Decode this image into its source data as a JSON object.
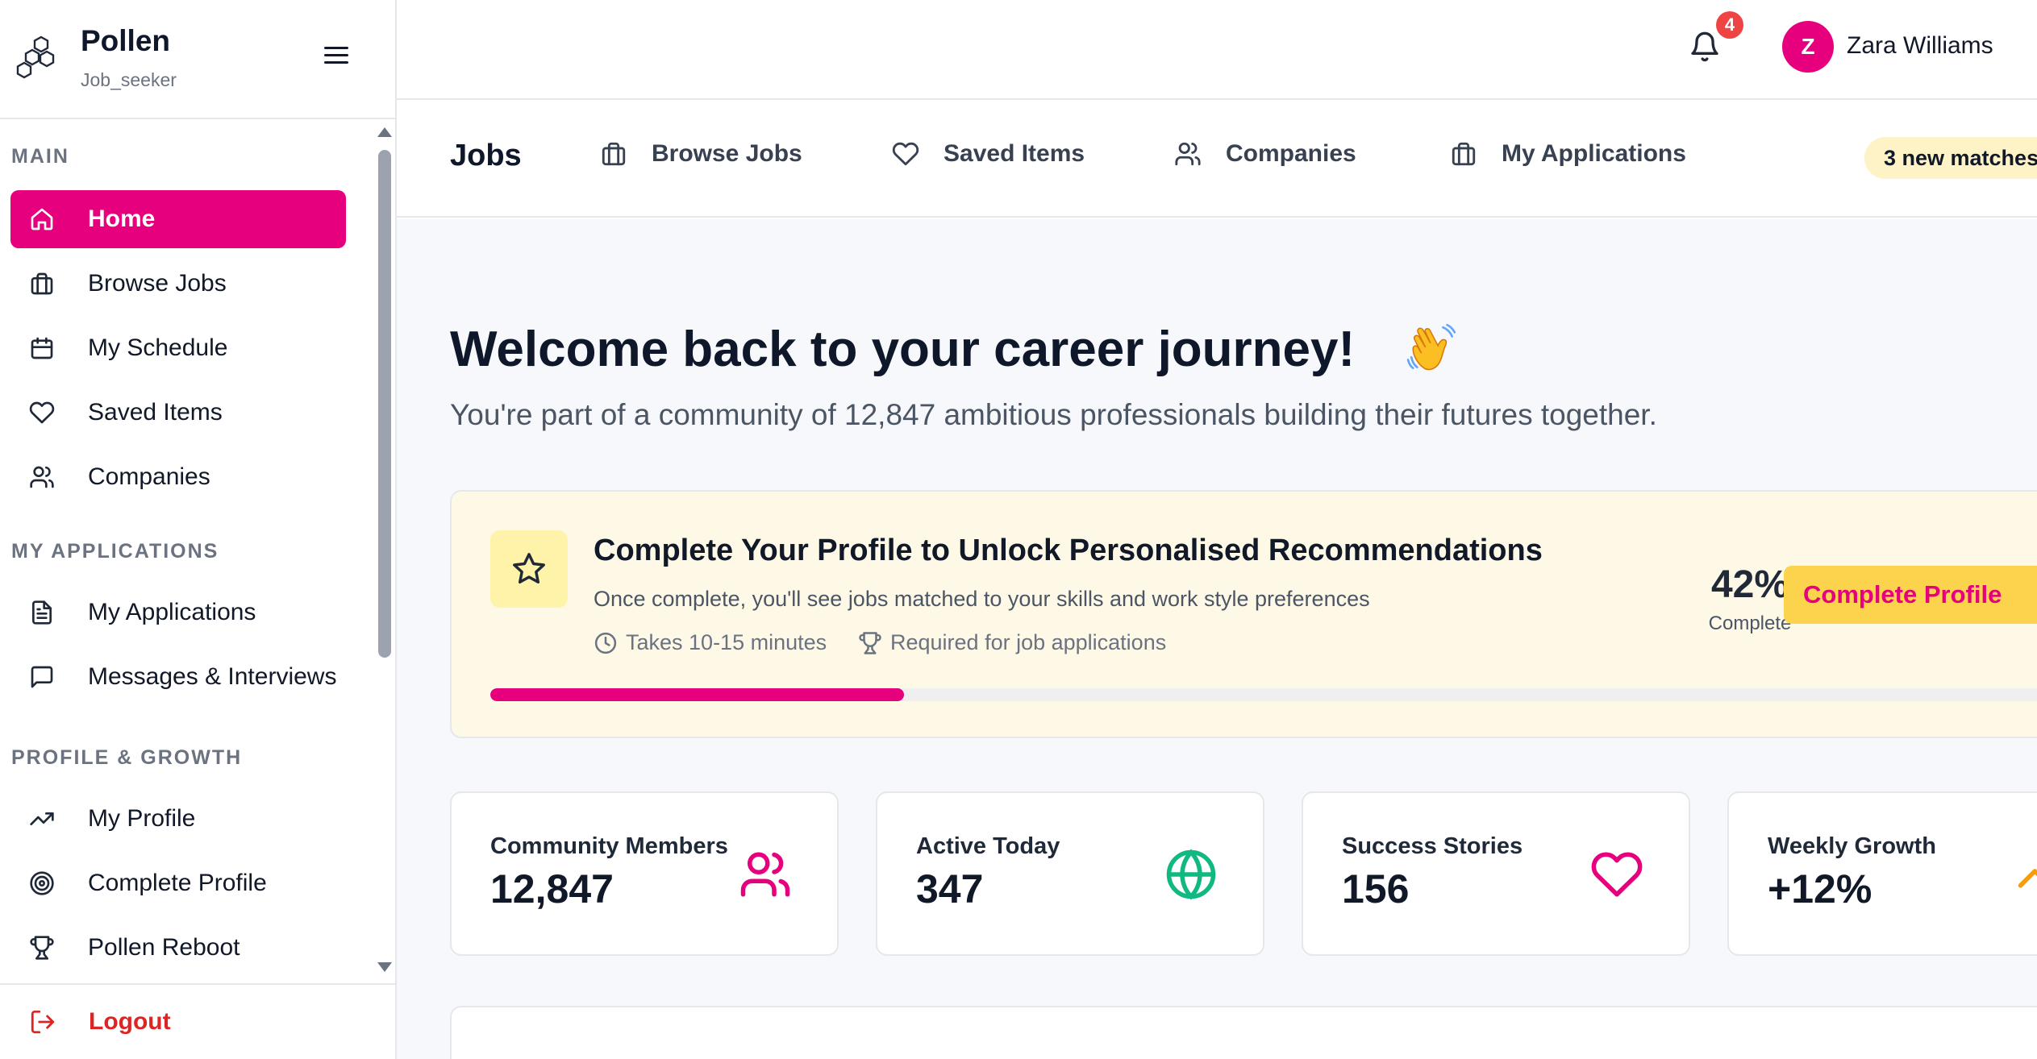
{
  "brand": {
    "name": "Pollen",
    "role": "Job_seeker"
  },
  "sidebar": {
    "sections": [
      {
        "label": "MAIN"
      },
      {
        "label": "MY APPLICATIONS"
      },
      {
        "label": "PROFILE & GROWTH"
      }
    ],
    "items": [
      {
        "label": "Home",
        "icon": "home-icon",
        "active": true
      },
      {
        "label": "Browse Jobs",
        "icon": "briefcase-icon"
      },
      {
        "label": "My Schedule",
        "icon": "calendar-icon"
      },
      {
        "label": "Saved Items",
        "icon": "heart-icon"
      },
      {
        "label": "Companies",
        "icon": "users-icon"
      },
      {
        "label": "My Applications",
        "icon": "document-icon"
      },
      {
        "label": "Messages & Interviews",
        "icon": "message-icon"
      },
      {
        "label": "My Profile",
        "icon": "trending-up-icon"
      },
      {
        "label": "Complete Profile",
        "icon": "target-icon"
      },
      {
        "label": "Pollen Reboot",
        "icon": "trophy-icon"
      }
    ],
    "logout": "Logout"
  },
  "topbar": {
    "notification_count": "4",
    "user_initial": "Z",
    "user_name": "Zara Williams"
  },
  "subnav": {
    "title": "Jobs",
    "links": [
      {
        "label": "Browse Jobs",
        "icon": "briefcase-icon"
      },
      {
        "label": "Saved Items",
        "icon": "heart-icon"
      },
      {
        "label": "Companies",
        "icon": "users-icon"
      },
      {
        "label": "My Applications",
        "icon": "briefcase-icon"
      }
    ],
    "badge": "3 new matches"
  },
  "welcome": {
    "title": "Welcome back to your career journey!",
    "subtitle": "You're part of a community of 12,847 ambitious professionals building their futures together."
  },
  "profile_card": {
    "title": "Complete Your Profile to Unlock Personalised Recommendations",
    "description": "Once complete, you'll see jobs matched to your skills and work style preferences",
    "meta_time": "Takes 10-15 minutes",
    "meta_required": "Required for job applications",
    "percent_text": "42%",
    "percent_label": "Complete",
    "progress_fraction": 0.263,
    "button": "Complete Profile"
  },
  "stats": [
    {
      "label": "Community Members",
      "value": "12,847",
      "icon": "users-icon",
      "color": "#e6007e"
    },
    {
      "label": "Active Today",
      "value": "347",
      "icon": "globe-icon",
      "color": "#10b981"
    },
    {
      "label": "Success Stories",
      "value": "156",
      "icon": "heart-icon",
      "color": "#e6007e"
    },
    {
      "label": "Weekly Growth",
      "value": "+12%",
      "icon": "trending-up-icon",
      "color": "#f59e0b"
    }
  ],
  "colors": {
    "accent": "#e6007e",
    "highlight": "#fcd34d",
    "badge": "#ef4444"
  }
}
